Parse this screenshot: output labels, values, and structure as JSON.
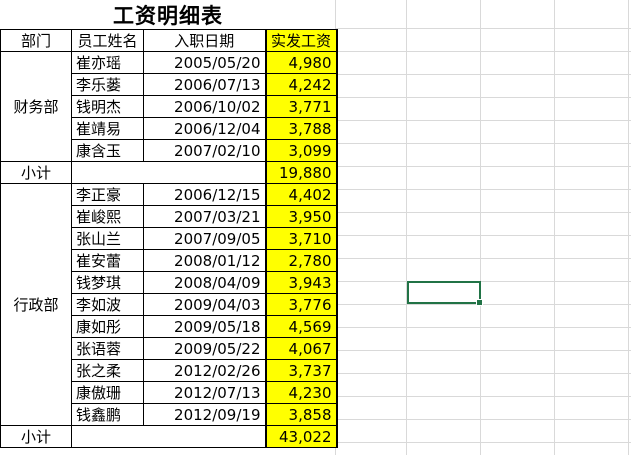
{
  "sheet": {
    "title": "工资明细表",
    "headers": {
      "department": "部门",
      "employee_name": "员工姓名",
      "hire_date": "入职日期",
      "net_salary": "实发工资"
    },
    "groups": [
      {
        "department": "财务部",
        "rows": [
          {
            "name": "崔亦瑶",
            "date": "2005/05/20",
            "salary": "4,980"
          },
          {
            "name": "李乐蒌",
            "date": "2006/07/13",
            "salary": "4,242"
          },
          {
            "name": "钱明杰",
            "date": "2006/10/02",
            "salary": "3,771"
          },
          {
            "name": "崔靖易",
            "date": "2006/12/04",
            "salary": "3,788"
          },
          {
            "name": "康含玉",
            "date": "2007/02/10",
            "salary": "3,099"
          }
        ],
        "subtotal_label": "小计",
        "subtotal": "19,880"
      },
      {
        "department": "行政部",
        "rows": [
          {
            "name": "李正豪",
            "date": "2006/12/15",
            "salary": "4,402"
          },
          {
            "name": "崔峻熙",
            "date": "2007/03/21",
            "salary": "3,950"
          },
          {
            "name": "张山兰",
            "date": "2007/09/05",
            "salary": "3,710"
          },
          {
            "name": "崔安蕾",
            "date": "2008/01/12",
            "salary": "2,780"
          },
          {
            "name": "钱梦琪",
            "date": "2008/04/09",
            "salary": "3,943"
          },
          {
            "name": "李如波",
            "date": "2009/04/03",
            "salary": "3,776"
          },
          {
            "name": "康如彤",
            "date": "2009/05/18",
            "salary": "4,569"
          },
          {
            "name": "张语蓉",
            "date": "2009/05/22",
            "salary": "4,067"
          },
          {
            "name": "张之柔",
            "date": "2012/02/26",
            "salary": "3,737"
          },
          {
            "name": "康傲珊",
            "date": "2012/07/13",
            "salary": "4,230"
          },
          {
            "name": "钱鑫鹏",
            "date": "2012/09/19",
            "salary": "3,858"
          }
        ],
        "subtotal_label": "小计",
        "subtotal": "43,022"
      }
    ]
  },
  "colors": {
    "highlight": "#ffff00",
    "selection": "#217346",
    "gridline": "#d9d9d9"
  }
}
